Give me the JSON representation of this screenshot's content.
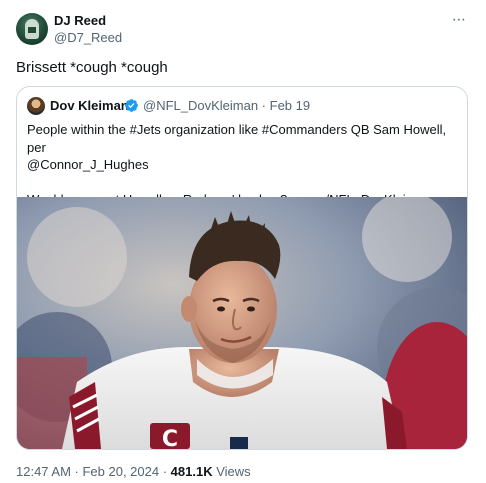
{
  "tweet": {
    "author_name": "DJ Reed",
    "author_handle": "@D7_Reed",
    "more_icon": "⋯",
    "text": "Brissett *cough *cough",
    "timestamp": "12:47 AM · Feb 20, 2024 · ",
    "views_count": "481.1K",
    "views_label": " Views"
  },
  "quote": {
    "author_name": "Dov Kleiman",
    "author_handle": "@NFL_DovKleiman · Feb 19",
    "verified_color": "#1d9bf0",
    "line1": "People within the #Jets organization like #Commanders QB Sam Howell, per",
    "line2": "@Connor_J_Hughes",
    "line3_text": "Would you want Howell as Rodgers' backup? ",
    "line3_link": "x.com/NFL_DovKleiman..."
  },
  "colors": {
    "text_primary": "#0f1419",
    "text_secondary": "#536471",
    "border": "#cfd9de",
    "jersey_burgundy": "#8a1a2b"
  }
}
